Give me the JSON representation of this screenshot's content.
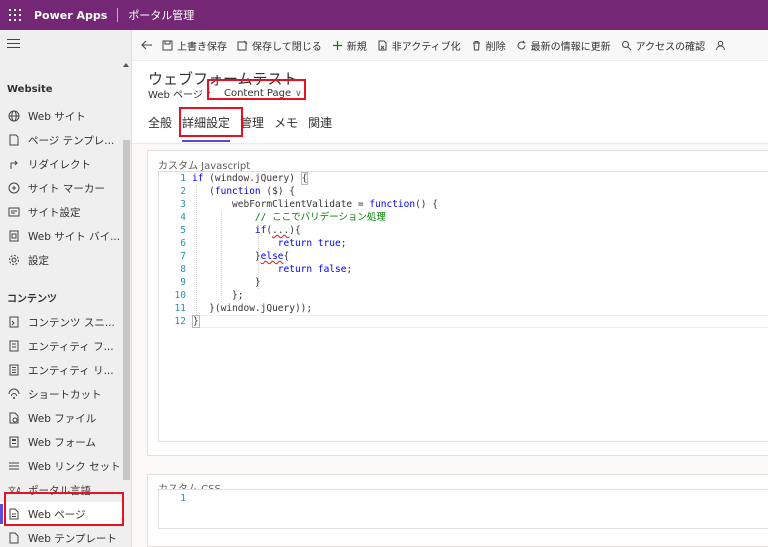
{
  "topbar": {
    "app_name": "Power Apps",
    "portal_label": "ポータル管理"
  },
  "sidebar": {
    "section1": "Website",
    "items1": [
      {
        "label": "Web サイト",
        "icon": "globe-icon"
      },
      {
        "label": "ページ テンプレ...",
        "icon": "page-template-icon"
      },
      {
        "label": "リダイレクト",
        "icon": "redirect-icon"
      },
      {
        "label": "サイト マーカー",
        "icon": "site-marker-icon"
      },
      {
        "label": "サイト設定",
        "icon": "site-settings-icon"
      },
      {
        "label": "Web サイト バイ...",
        "icon": "website-binding-icon"
      },
      {
        "label": "設定",
        "icon": "gear-icon"
      }
    ],
    "section2": "コンテンツ",
    "items2": [
      {
        "label": "コンテンツ スニ...",
        "icon": "snippet-icon"
      },
      {
        "label": "エンティティ フ...",
        "icon": "entity-form-icon"
      },
      {
        "label": "エンティティ リ...",
        "icon": "entity-list-icon"
      },
      {
        "label": "ショートカット",
        "icon": "shortcut-icon"
      },
      {
        "label": "Web ファイル",
        "icon": "web-file-icon"
      },
      {
        "label": "Web フォーム",
        "icon": "web-form-icon"
      },
      {
        "label": "Web リンク セット",
        "icon": "link-set-icon"
      },
      {
        "label": "ポータル言語",
        "icon": "portal-language-icon"
      },
      {
        "label": "Web ページ",
        "icon": "web-page-icon",
        "active": true
      },
      {
        "label": "Web テンプレート",
        "icon": "web-template-icon"
      }
    ]
  },
  "commandbar": [
    {
      "label": "上書き保存",
      "icon": "save-icon"
    },
    {
      "label": "保存して閉じる",
      "icon": "save-close-icon"
    },
    {
      "label": "新規",
      "icon": "plus-icon"
    },
    {
      "label": "非アクティブ化",
      "icon": "deactivate-icon"
    },
    {
      "label": "削除",
      "icon": "trash-icon"
    },
    {
      "label": "最新の情報に更新",
      "icon": "refresh-icon"
    },
    {
      "label": "アクセスの確認",
      "icon": "access-check-icon"
    }
  ],
  "header": {
    "title": "ウェブフォームテスト",
    "entity": "Web ページ",
    "form_selector": "Content Page"
  },
  "tabs": [
    "全般",
    "詳細設定",
    "管理",
    "メモ",
    "関連"
  ],
  "active_tab": "詳細設定",
  "js_section": {
    "label": "カスタム Javascript",
    "lines": [
      "if (window.jQuery) {",
      "   (function ($) {",
      "       webFormClientValidate = function() {",
      "           // ここでバリデーション処理",
      "           if(...){",
      "               return true;",
      "           }else{",
      "               return false;",
      "           }",
      "       };",
      "   }(window.jQuery));",
      "}"
    ]
  },
  "css_section": {
    "label": "カスタム CSS",
    "lines": [
      ""
    ]
  },
  "colors": {
    "accent": "#742774",
    "highlight": "#e81123",
    "selection": "#5b4bdb"
  }
}
